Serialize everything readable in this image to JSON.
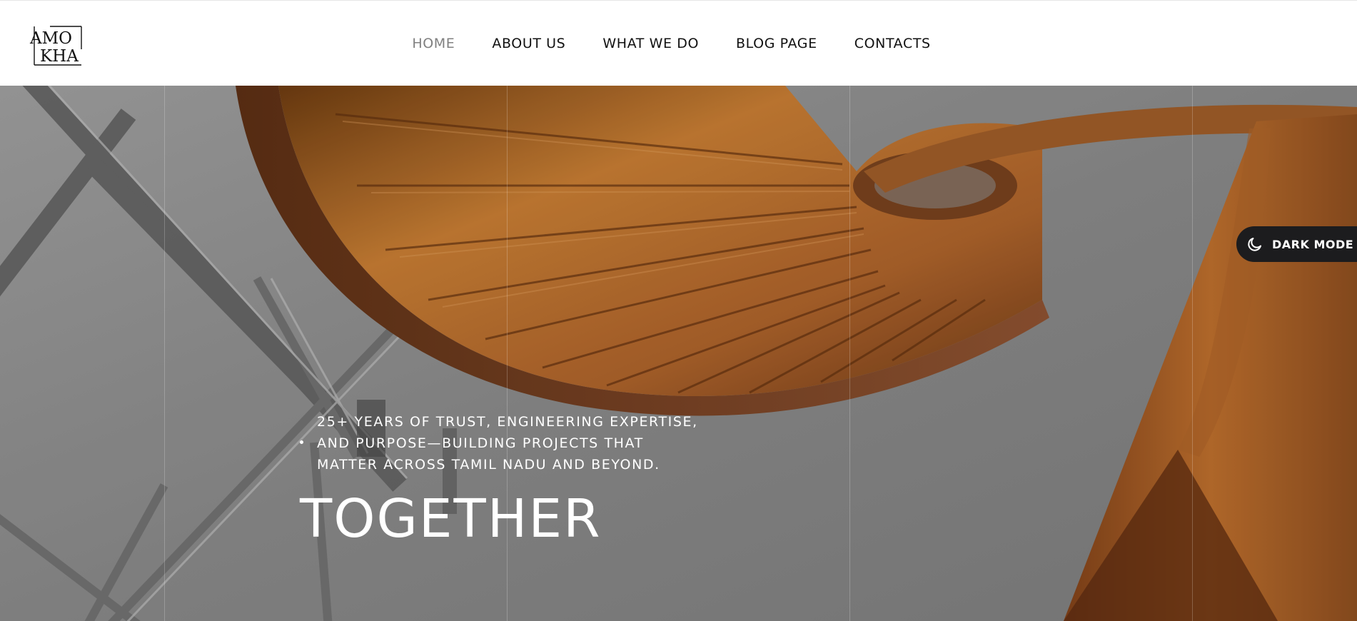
{
  "brand": {
    "logo_text_line1": "AMO",
    "logo_text_line2": "KHA"
  },
  "nav": {
    "items": [
      {
        "label": "HOME",
        "active": true
      },
      {
        "label": "ABOUT US",
        "active": false
      },
      {
        "label": "WHAT WE DO",
        "active": false
      },
      {
        "label": "BLOG PAGE",
        "active": false
      },
      {
        "label": "CONTACTS",
        "active": false
      }
    ]
  },
  "theme_toggle": {
    "label": "DARK MODE",
    "icon": "moon-icon"
  },
  "hero": {
    "tagline_lines": [
      "25+ YEARS OF TRUST, ENGINEERING EXPERTISE,",
      "AND PURPOSE—BUILDING PROJECTS THAT",
      "MATTER ACROSS TAMIL NADU AND BEYOND."
    ],
    "headline": "TOGETHER"
  },
  "colors": {
    "header_bg": "#ffffff",
    "nav_text": "#111111",
    "nav_active": "#808080",
    "toggle_bg": "#1c1c1e",
    "wood": "#b06a2a",
    "hero_gray": "#8a8a8a"
  }
}
